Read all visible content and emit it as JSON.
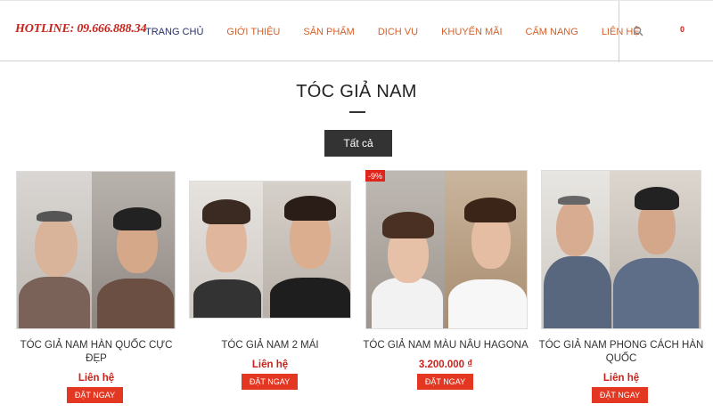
{
  "header": {
    "hotline": "HOTLINE: 09.666.888.34",
    "nav": [
      "TRANG CHỦ",
      "GIỚI THIỆU",
      "SẢN PHẨM",
      "DỊCH VỤ",
      "KHUYẾN MÃI",
      "CẨM NANG",
      "LIÊN HỆ"
    ],
    "cart_count": "0",
    "icons": {
      "search": "search-icon"
    }
  },
  "section": {
    "title": "TÓC GIẢ NAM",
    "filter_label": "Tất cả"
  },
  "products": [
    {
      "name_line1": "TÓC GIẢ NAM HÀN QUỐC CỰC",
      "name_line2": "ĐẸP",
      "price": "Liên hệ",
      "button": "ĐẶT NGAY"
    },
    {
      "name_line1": "TÓC GIẢ NAM 2 MÁI",
      "name_line2": "",
      "price": "Liên hệ",
      "button": "ĐẶT NGAY"
    },
    {
      "name_line1": "TÓC GIẢ NAM MÀU NÂU HAGONA",
      "name_line2": "",
      "price": "3.200.000 ₫",
      "button": "ĐẶT NGAY",
      "badge": "-9%"
    },
    {
      "name_line1": "TÓC GIẢ NAM PHONG CÁCH HÀN",
      "name_line2": "QUỐC",
      "price": "Liên hệ",
      "button": "ĐẶT NGAY"
    }
  ],
  "colors": {
    "accent": "#e43722",
    "nav": "#d4602a",
    "nav_active": "#27316b",
    "hotline": "#c8231b"
  }
}
